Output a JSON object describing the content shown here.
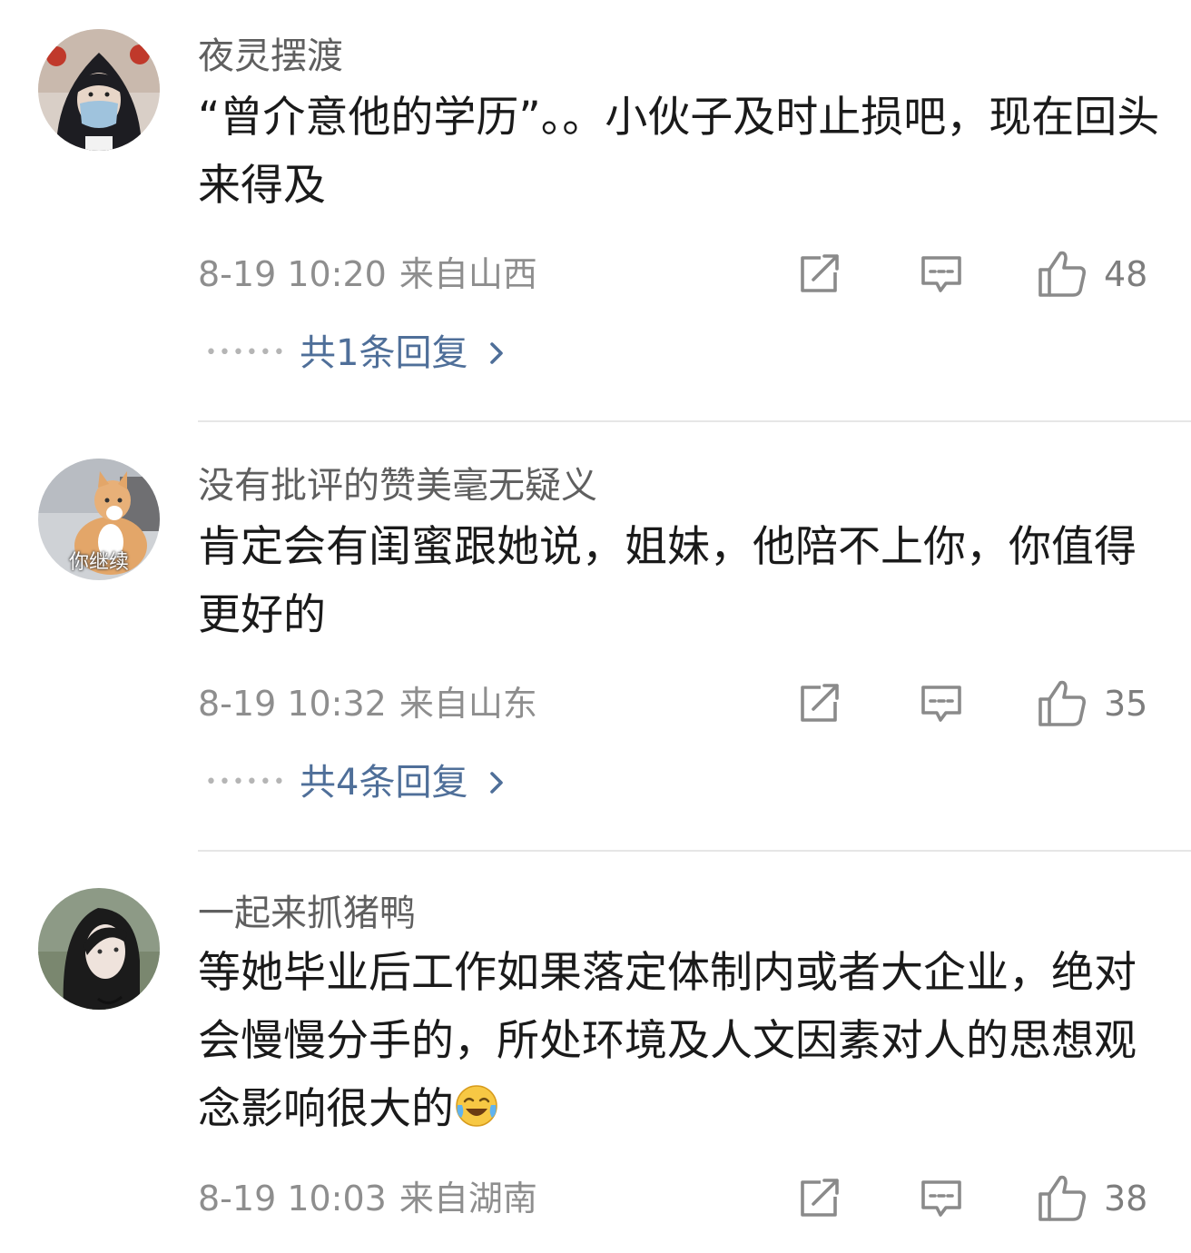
{
  "comments": [
    {
      "username": "夜灵摆渡",
      "text": "“曾介意他的学历”。。小伙子及时止损吧，现在回头来得及",
      "date": "8-19 10:20",
      "location": "来自山西",
      "likes": "48",
      "replies_label": "共1条回复",
      "avatar_icon": "hooded-person-masked-avatar"
    },
    {
      "username": "没有批评的赞美毫无疑义",
      "text": "肯定会有闺蜜跟她说，姐妹，他陪不上你，你值得更好的",
      "date": "8-19 10:32",
      "location": "来自山东",
      "likes": "35",
      "replies_label": "共4条回复",
      "avatar_icon": "cat-avatar",
      "avatar_caption": "你继续"
    },
    {
      "username": "一起来抓猪鸭",
      "text": "等她毕业后工作如果落定体制内或者大企业，绝对会慢慢分手的，所处环境及人文因素对人的思想观念影响很大的",
      "emoji": "laugh-cry-emoji",
      "date": "8-19 10:03",
      "location": "来自湖南",
      "likes": "38",
      "avatar_icon": "woman-portrait-avatar"
    }
  ],
  "icons": {
    "share": "share-icon",
    "comment": "comment-icon",
    "like": "thumbs-up-icon",
    "more_replies": "chevron-right-icon"
  },
  "colors": {
    "username": "#5f5f5f",
    "body": "#1a1a1a",
    "meta": "#8e8e8e",
    "reply_link": "#4f6f99",
    "divider": "#e6e6e6"
  }
}
